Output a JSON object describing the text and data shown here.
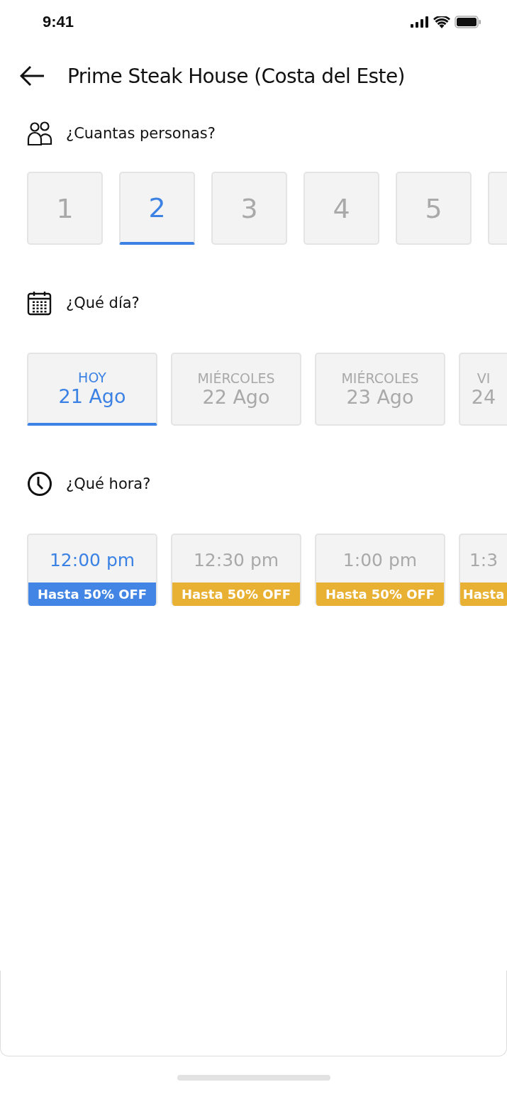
{
  "status_bar": {
    "time": "9:41"
  },
  "header": {
    "title": "Prime Steak House (Costa del Este)"
  },
  "party_size": {
    "heading": "¿Cuantas personas?",
    "options": [
      {
        "label": "1",
        "selected": false
      },
      {
        "label": "2",
        "selected": true
      },
      {
        "label": "3",
        "selected": false
      },
      {
        "label": "4",
        "selected": false
      },
      {
        "label": "5",
        "selected": false
      },
      {
        "selected": false
      }
    ]
  },
  "day": {
    "heading": "¿Qué día?",
    "options": [
      {
        "weekday": "HOY",
        "date": "21 Ago",
        "selected": true
      },
      {
        "weekday": "MIÉRCOLES",
        "date": "22 Ago",
        "selected": false
      },
      {
        "weekday": "MIÉRCOLES",
        "date": "23 Ago",
        "selected": false
      },
      {
        "weekday": "VI",
        "date": "24",
        "selected": false
      }
    ]
  },
  "time": {
    "heading": "¿Qué hora?",
    "options": [
      {
        "time": "12:00 pm",
        "offer": "Hasta 50% OFF",
        "selected": true
      },
      {
        "time": "12:30 pm",
        "offer": "Hasta 50% OFF",
        "selected": false
      },
      {
        "time": "1:00 pm",
        "offer": "Hasta 50% OFF",
        "selected": false
      },
      {
        "time": "1:3",
        "offer": "Hasta",
        "selected": false
      }
    ]
  }
}
